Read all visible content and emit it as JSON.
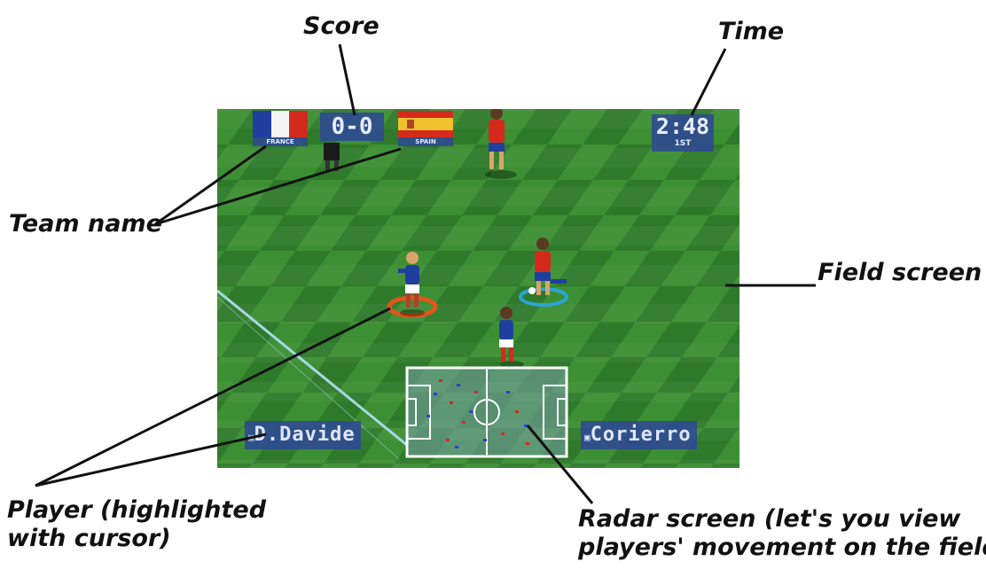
{
  "annotations": {
    "score": "Score",
    "time": "Time",
    "team_name": "Team name",
    "field_screen": "Field screen",
    "player_line1": "Player (highlighted",
    "player_line2": "with cursor)",
    "radar_line1": "Radar screen (let's you view",
    "radar_line2": "players' movement on the field)"
  },
  "hud": {
    "home_team": "FRANCE",
    "away_team": "SPAIN",
    "score": "0-0",
    "time": "2:48",
    "half": "1ST",
    "home_player": "D.Davide",
    "away_player": "Corierro"
  },
  "colors": {
    "pitch_dark": "#2f7a2a",
    "pitch_light": "#3f9434",
    "hud_blue": "#2d4696",
    "france_blue": "#1f3f9f",
    "spain_red": "#d42a1d",
    "spain_yellow": "#f2c12e"
  }
}
